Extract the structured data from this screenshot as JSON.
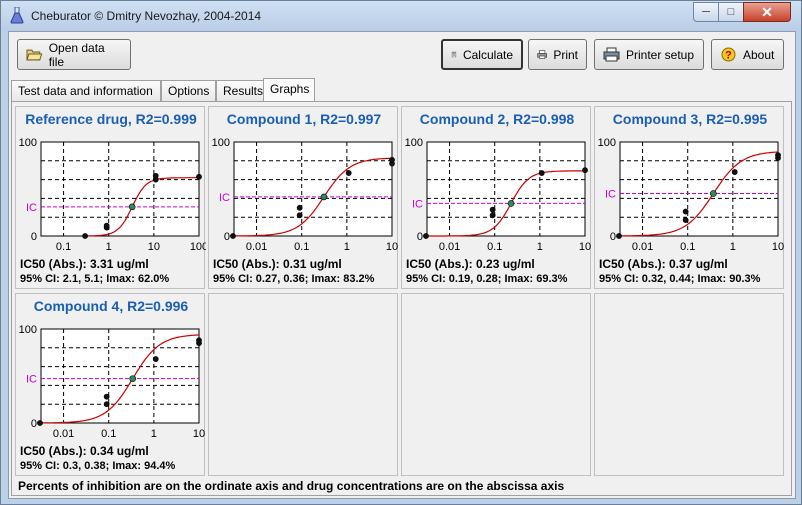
{
  "window": {
    "title": "Cheburator © Dmitry Nevozhay, 2004-2014"
  },
  "toolbar": {
    "open_label": "Open data file",
    "calc_label": "Calculate",
    "print_label": "Print",
    "setup_label": "Printer setup",
    "about_label": "About"
  },
  "tabs": [
    {
      "label": "Test data and information"
    },
    {
      "label": "Options"
    },
    {
      "label": "Results"
    },
    {
      "label": "Graphs"
    }
  ],
  "footer": {
    "text": "Percents of inhibition are on the ordinate axis and drug concentrations are on the abscissa axis"
  },
  "colors": {
    "title": "#1a5fb4",
    "curve": "#cc0000",
    "ic_line": "#cc00cc",
    "midpoint": "#2e8b57"
  },
  "chart_data": [
    {
      "type": "scatter",
      "title": "Reference drug, R2=0.999",
      "ic50": "IC50 (Abs.): 3.31 ug/ml",
      "ci": "95% CI:  2.1, 5.1; Imax: 62.0%",
      "y_ticks": [
        "0",
        "100"
      ],
      "ic_label": "IC",
      "x_ticks": [
        "0.1",
        "1",
        "10",
        "100"
      ],
      "xlim_log": [
        -1.5,
        2.0
      ],
      "ylim": [
        0,
        100
      ],
      "ic50_value": 3.31,
      "imax": 62.0,
      "hill": 2.8,
      "points": [
        [
          0.3,
          0
        ],
        [
          0.9,
          9
        ],
        [
          0.9,
          11
        ],
        [
          11,
          60
        ],
        [
          11,
          64
        ],
        [
          100,
          63
        ]
      ]
    },
    {
      "type": "scatter",
      "title": "Compound 1, R2=0.997",
      "ic50": "IC50 (Abs.): 0.31 ug/ml",
      "ci": "95% CI:  0.27, 0.36; Imax: 83.2%",
      "y_ticks": [
        "0",
        "100"
      ],
      "ic_label": "IC",
      "x_ticks": [
        "0.01",
        "0.1",
        "1",
        "10"
      ],
      "xlim_log": [
        -2.5,
        1.0
      ],
      "ylim": [
        0,
        100
      ],
      "ic50_value": 0.31,
      "imax": 83.2,
      "hill": 1.5,
      "points": [
        [
          0.003,
          0
        ],
        [
          0.09,
          22
        ],
        [
          0.09,
          30
        ],
        [
          1.1,
          67
        ],
        [
          10,
          77
        ],
        [
          10,
          81
        ]
      ]
    },
    {
      "type": "scatter",
      "title": "Compound 2, R2=0.998",
      "ic50": "IC50 (Abs.): 0.23 ug/ml",
      "ci": "95% CI:  0.19, 0.28; Imax: 69.3%",
      "y_ticks": [
        "0",
        "100"
      ],
      "ic_label": "IC",
      "x_ticks": [
        "0.01",
        "0.1",
        "1",
        "10"
      ],
      "xlim_log": [
        -2.5,
        1.0
      ],
      "ylim": [
        0,
        100
      ],
      "ic50_value": 0.23,
      "imax": 69.3,
      "hill": 2.2,
      "points": [
        [
          0.003,
          0
        ],
        [
          0.09,
          22
        ],
        [
          0.09,
          28
        ],
        [
          1.1,
          67
        ],
        [
          10,
          70
        ]
      ]
    },
    {
      "type": "scatter",
      "title": "Compound 3, R2=0.995",
      "ic50": "IC50 (Abs.): 0.37 ug/ml",
      "ci": "95% CI:  0.32, 0.44; Imax: 90.3%",
      "y_ticks": [
        "0",
        "100"
      ],
      "ic_label": "IC",
      "x_ticks": [
        "0.01",
        "0.1",
        "1",
        "10"
      ],
      "xlim_log": [
        -2.5,
        1.0
      ],
      "ylim": [
        0,
        100
      ],
      "ic50_value": 0.37,
      "imax": 90.3,
      "hill": 1.4,
      "points": [
        [
          0.003,
          0
        ],
        [
          0.09,
          17
        ],
        [
          0.09,
          26
        ],
        [
          1.1,
          68
        ],
        [
          10,
          83
        ],
        [
          10,
          86
        ]
      ]
    },
    {
      "type": "scatter",
      "title": "Compound 4, R2=0.996",
      "ic50": "IC50 (Abs.): 0.34 ug/ml",
      "ci": "95% CI:  0.3, 0.38; Imax: 94.4%",
      "y_ticks": [
        "0",
        "100"
      ],
      "ic_label": "IC",
      "x_ticks": [
        "0.01",
        "0.1",
        "1",
        "10"
      ],
      "xlim_log": [
        -2.5,
        1.0
      ],
      "ylim": [
        0,
        100
      ],
      "ic50_value": 0.34,
      "imax": 94.4,
      "hill": 1.45,
      "points": [
        [
          0.003,
          0
        ],
        [
          0.09,
          20
        ],
        [
          0.09,
          28
        ],
        [
          1.1,
          68
        ],
        [
          10,
          85
        ],
        [
          10,
          88
        ]
      ]
    }
  ]
}
